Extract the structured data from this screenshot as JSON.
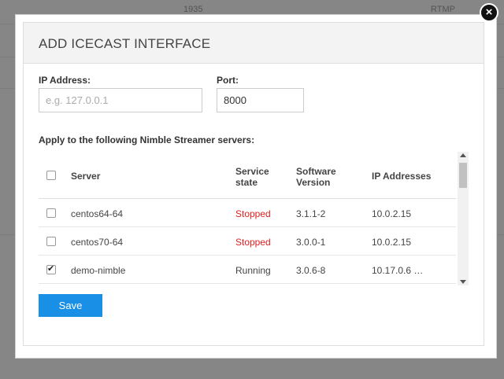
{
  "background": {
    "cells": [
      "1935",
      "RTMP"
    ]
  },
  "modal": {
    "title": "ADD ICECAST INTERFACE",
    "close_label": "×",
    "ip_label": "IP Address:",
    "ip_placeholder": "e.g. 127.0.0.1",
    "ip_value": "",
    "port_label": "Port:",
    "port_value": "8000",
    "apply_label": "Apply to the following Nimble Streamer servers:",
    "save_label": "Save"
  },
  "table": {
    "headers": {
      "server": "Server",
      "state_line1": "Service",
      "state_line2": "state",
      "version_line1": "Software",
      "version_line2": "Version",
      "ip": "IP Addresses"
    },
    "rows": [
      {
        "server": "centos64-64",
        "state": "Stopped",
        "version": "3.1.1-2",
        "ip": "10.0.2.15",
        "checked": false
      },
      {
        "server": "centos70-64",
        "state": "Stopped",
        "version": "3.0.0-1",
        "ip": "10.0.2.15",
        "checked": false
      },
      {
        "server": "demo-nimble",
        "state": "Running",
        "version": "3.0.6-8",
        "ip": "10.17.0.6 …",
        "checked": true
      }
    ]
  },
  "colors": {
    "accent": "#1a8fe6",
    "stopped": "#e02020"
  }
}
